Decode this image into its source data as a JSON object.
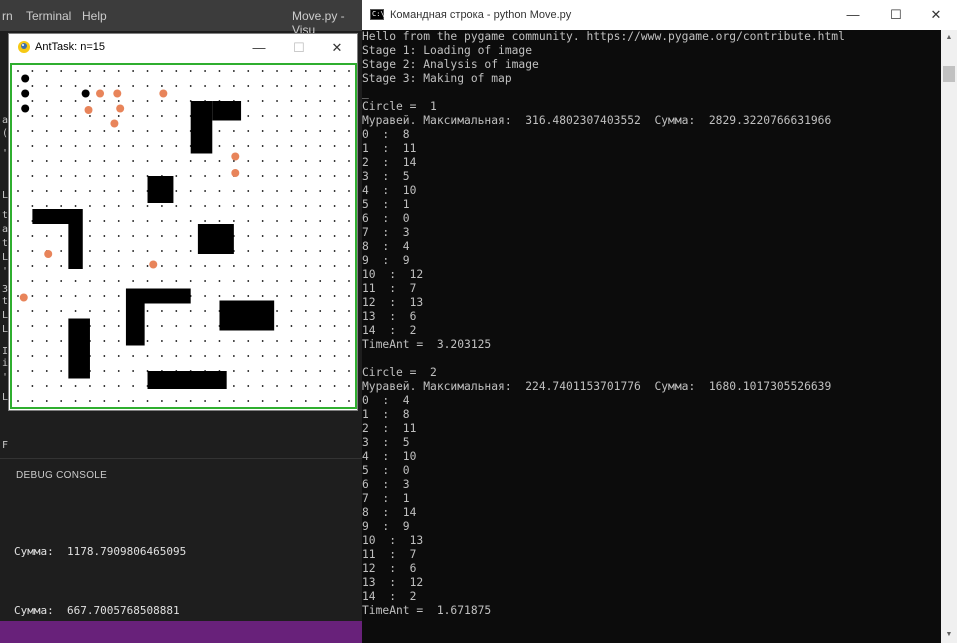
{
  "vscode": {
    "menu": [
      "rn",
      "Terminal",
      "Help"
    ],
    "title": "Move.py - Visu",
    "gutter_chars": [
      "a",
      "(",
      "'",
      "t",
      "a",
      "t",
      "L",
      "'",
      "3",
      "t",
      "L",
      "L",
      "I",
      "i",
      "F",
      "L",
      "'",
      "L"
    ],
    "debug_title": "DEBUG CONSOLE",
    "debug_lines": [
      "Сумма:  1178.7909806465095",
      "Сумма:  667.7005768508881"
    ]
  },
  "ant_window": {
    "title": "AntTask: n=15",
    "minimize": "—",
    "maximize": "☐",
    "close": "✕",
    "grid": {
      "cols": 24,
      "rows": 23,
      "dot_color": "#000000"
    },
    "obstacles": [
      {
        "x": 12,
        "y": 2,
        "w": 1.5,
        "h": 3.5
      },
      {
        "x": 13.5,
        "y": 2,
        "w": 2,
        "h": 1.3
      },
      {
        "x": 1,
        "y": 9.2,
        "w": 3.5,
        "h": 1
      },
      {
        "x": 3.5,
        "y": 10.2,
        "w": 1,
        "h": 3
      },
      {
        "x": 12.5,
        "y": 10.2,
        "w": 2.5,
        "h": 2
      },
      {
        "x": 9,
        "y": 7,
        "w": 1.8,
        "h": 1.8
      },
      {
        "x": 7.5,
        "y": 14.5,
        "w": 4.5,
        "h": 1
      },
      {
        "x": 7.5,
        "y": 15.5,
        "w": 1.3,
        "h": 2.8
      },
      {
        "x": 14,
        "y": 15.3,
        "w": 3.8,
        "h": 2
      },
      {
        "x": 3.5,
        "y": 16.5,
        "w": 1.5,
        "h": 4
      },
      {
        "x": 9,
        "y": 20,
        "w": 5.5,
        "h": 1.2
      }
    ],
    "black_ants": [
      [
        0.5,
        0.5
      ],
      [
        0.5,
        1.5
      ],
      [
        0.5,
        2.5
      ],
      [
        4.7,
        1.5
      ]
    ],
    "orange_ants": [
      [
        5.7,
        1.5
      ],
      [
        6.9,
        1.5
      ],
      [
        10.1,
        1.5
      ],
      [
        4.9,
        2.6
      ],
      [
        7.1,
        2.5
      ],
      [
        6.7,
        3.5
      ],
      [
        15.1,
        5.7
      ],
      [
        15.1,
        6.8
      ],
      [
        2.1,
        12.2
      ],
      [
        9.4,
        12.9
      ],
      [
        0.4,
        15.1
      ]
    ],
    "black_ant_color": "#000000",
    "orange_ant_color": "#e8845a",
    "border_color": "#2fae2f"
  },
  "cmd_window": {
    "title": "Командная строка - python  Move.py",
    "minimize": "—",
    "maximize": "☐",
    "close": "✕",
    "lines": [
      "Hello from the pygame community. https://www.pygame.org/contribute.html",
      "Stage 1: Loading of image",
      "Stage 2: Analysis of image",
      "Stage 3: Making of map",
      "_",
      "Circle =  1",
      "Муравей. Максимальная:  316.4802307403552  Сумма:  2829.3220766631966",
      "0  :  8",
      "1  :  11",
      "2  :  14",
      "3  :  5",
      "4  :  10",
      "5  :  1",
      "6  :  0",
      "7  :  3",
      "8  :  4",
      "9  :  9",
      "10  :  12",
      "11  :  7",
      "12  :  13",
      "13  :  6",
      "14  :  2",
      "TimeAnt =  3.203125",
      "",
      "Circle =  2",
      "Муравей. Максимальная:  224.7401153701776  Сумма:  1680.1017305526639",
      "0  :  4",
      "1  :  8",
      "2  :  11",
      "3  :  5",
      "4  :  10",
      "5  :  0",
      "6  :  3",
      "7  :  1",
      "8  :  14",
      "9  :  9",
      "10  :  13",
      "11  :  7",
      "12  :  6",
      "13  :  12",
      "14  :  2",
      "TimeAnt =  1.671875"
    ]
  }
}
